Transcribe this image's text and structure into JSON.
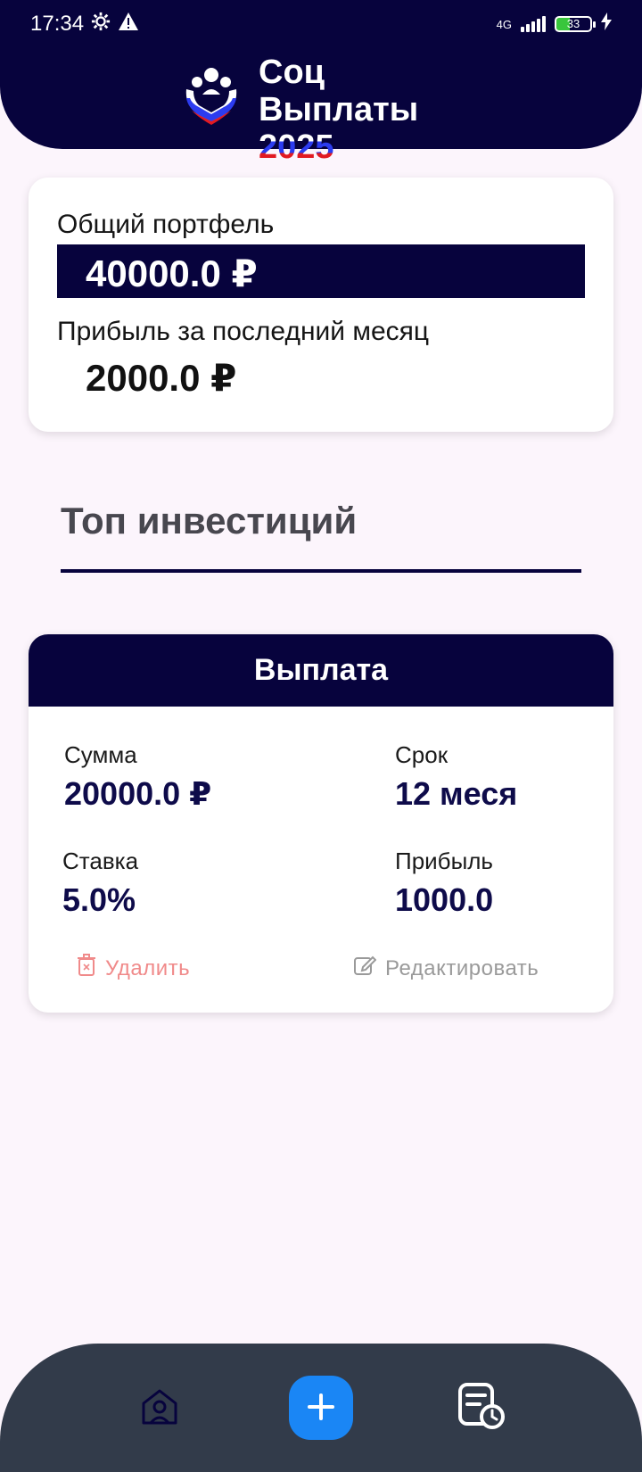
{
  "status_bar": {
    "time": "17:34",
    "network": "4G",
    "battery": "33"
  },
  "app": {
    "title_line1": "Соц Выплаты",
    "title_line2": "2025"
  },
  "portfolio": {
    "total_label": "Общий портфель",
    "total_value": "40000.0 ₽",
    "profit_label": "Прибыль за последний месяц",
    "profit_value": "2000.0 ₽"
  },
  "top_section": {
    "title": "Топ инвестиций"
  },
  "investment": {
    "header": "Выплата",
    "sum_label": "Сумма",
    "sum_value": "20000.0 ₽",
    "term_label": "Срок",
    "term_value": "12 меся",
    "rate_label": "Ставка",
    "rate_value": "5.0%",
    "profit_label": "Прибыль",
    "profit_value": "1000.0",
    "delete_label": "Удалить",
    "edit_label": "Редактировать"
  },
  "nav": {
    "items": [
      {
        "icon": "home-person-icon"
      },
      {
        "icon": "plus-icon"
      },
      {
        "icon": "history-icon"
      }
    ]
  },
  "colors": {
    "primary_navy": "#07033d",
    "background": "#fcf5fc",
    "nav_bar": "#323b4a",
    "fab_blue": "#1a86f5",
    "delete_red": "#f08a8a"
  }
}
